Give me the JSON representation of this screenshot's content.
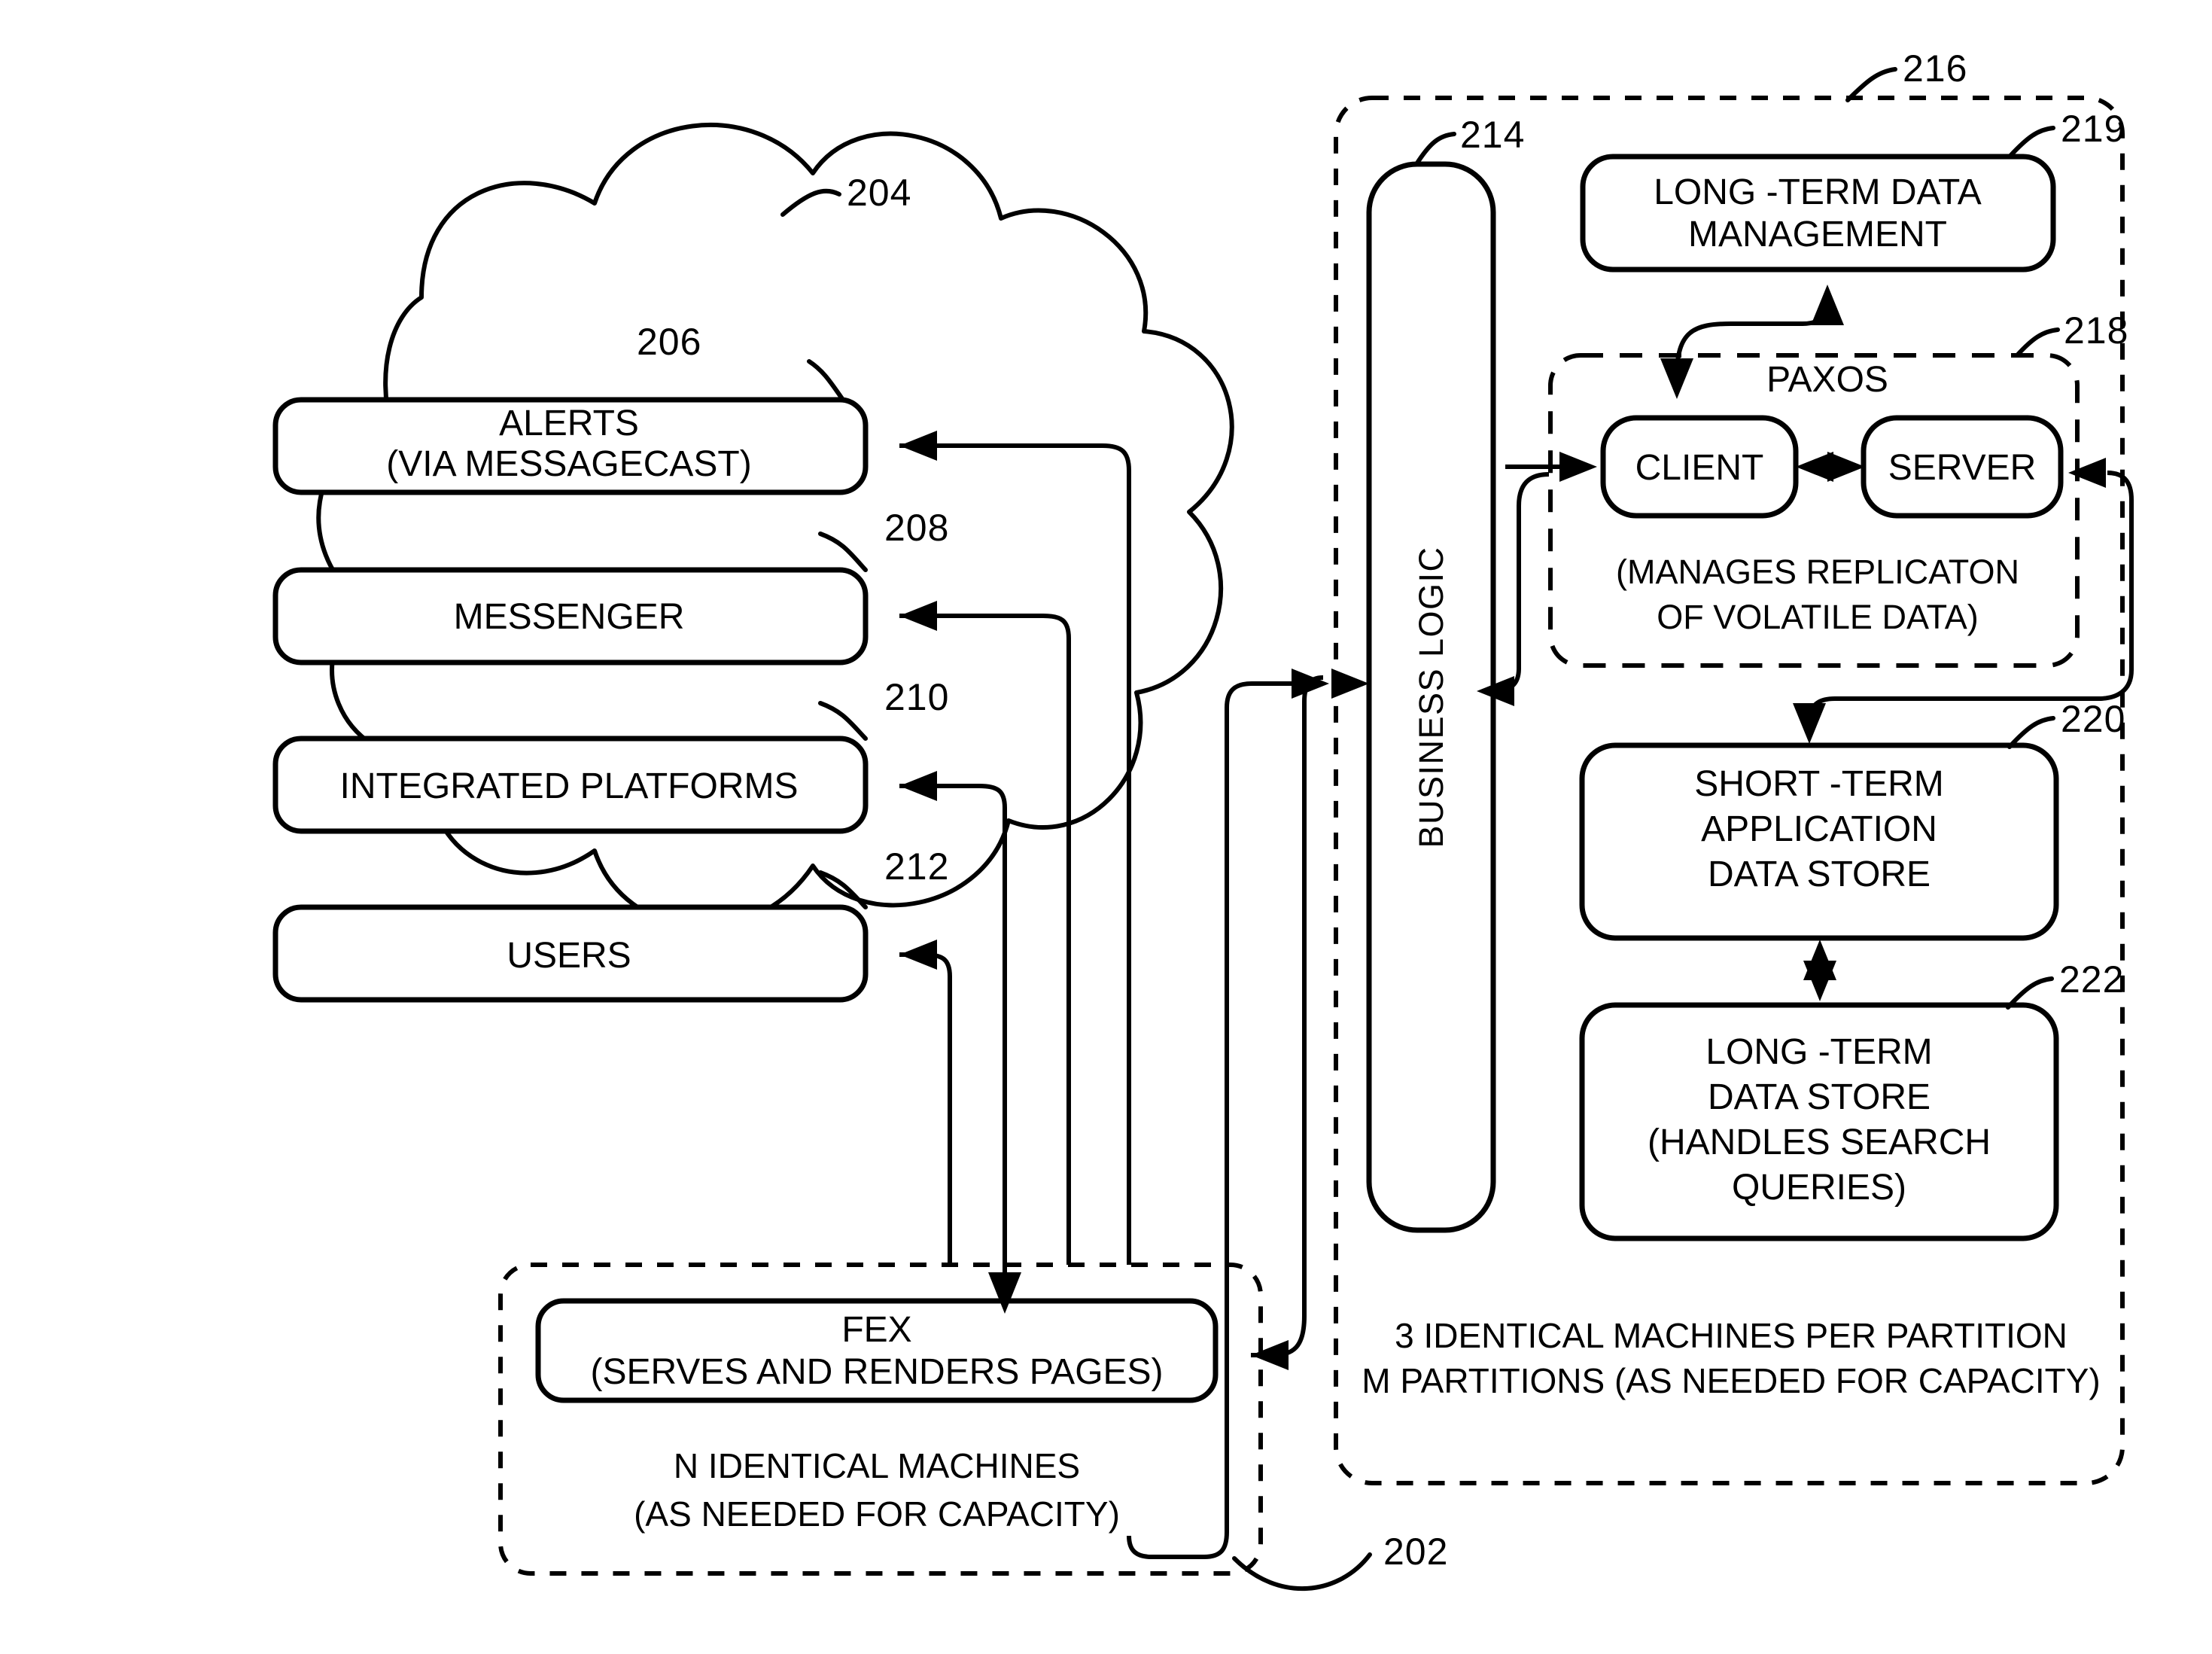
{
  "figure": {
    "type": "patent-architecture-diagram",
    "background": "#ffffff",
    "ink": "#000000"
  },
  "reference_numerals": {
    "cloud": "204",
    "alerts": "206",
    "messenger": "208",
    "integrated_platforms": "210",
    "users": "212",
    "business_logic": "214",
    "backend_partition": "216",
    "paxos": "218",
    "long_term_data_management": "219",
    "short_term_application_data_store": "220",
    "long_term_data_store": "222",
    "fex_group": "202"
  },
  "cloud": {
    "name": "client-cloud",
    "items": [
      {
        "id": "alerts",
        "line1": "ALERTS",
        "line2": "(VIA MESSAGECAST)",
        "ref": "206"
      },
      {
        "id": "messenger",
        "line1": "MESSENGER",
        "line2": "",
        "ref": "208"
      },
      {
        "id": "integrated-platforms",
        "line1": "INTEGRATED PLATFORMS",
        "line2": "",
        "ref": "210"
      },
      {
        "id": "users",
        "line1": "USERS",
        "line2": "",
        "ref": "212"
      }
    ]
  },
  "fex_group": {
    "ref": "202",
    "box": {
      "line1": "FEX",
      "line2": "(SERVES AND RENDERS PAGES)"
    },
    "caption_line1": "N IDENTICAL MACHINES",
    "caption_line2": "(AS NEEDED FOR CAPACITY)"
  },
  "backend": {
    "ref": "216",
    "business_logic": {
      "ref": "214",
      "label": "BUSINESS LOGIC"
    },
    "long_term_data_management": {
      "ref": "219",
      "line1": "LONG -TERM DATA",
      "line2": "MANAGEMENT"
    },
    "paxos": {
      "ref": "218",
      "title": "PAXOS",
      "client_label": "CLIENT",
      "server_label": "SERVER",
      "note_line1": "(MANAGES REPLICATON",
      "note_line2": "OF  VOLATILE DATA)"
    },
    "short_term_application_data_store": {
      "ref": "220",
      "line1": "SHORT -TERM",
      "line2": "APPLICATION",
      "line3": "DATA STORE"
    },
    "long_term_data_store": {
      "ref": "222",
      "line1": "LONG -TERM",
      "line2": "DATA STORE",
      "line3": "(HANDLES SEARCH",
      "line4": "QUERIES)"
    },
    "caption_line1": "3 IDENTICAL MACHINES PER PARTITION",
    "caption_line2": "M PARTITIONS (AS NEEDED FOR CAPACITY)"
  }
}
